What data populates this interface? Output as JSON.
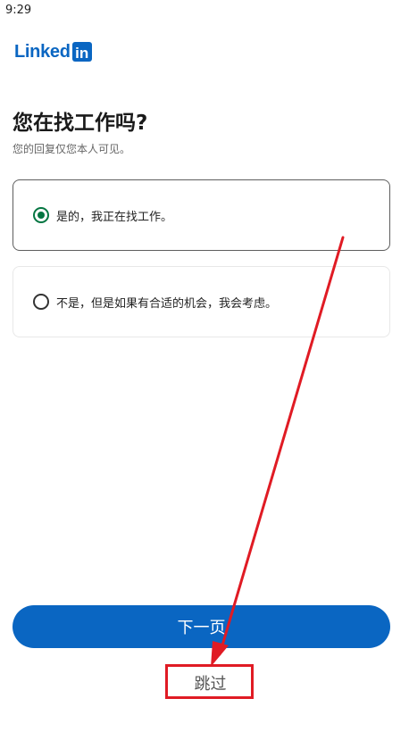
{
  "status_bar": {
    "time": "9:29"
  },
  "logo": {
    "word": "Linked",
    "box": "in"
  },
  "question": {
    "title": "您在找工作吗?",
    "subtitle": "您的回复仅您本人可见。"
  },
  "options": [
    {
      "label": "是的，我正在找工作。",
      "selected": true
    },
    {
      "label": "不是，但是如果有合适的机会，我会考虑。",
      "selected": false
    }
  ],
  "actions": {
    "next_label": "下一页",
    "skip_label": "跳过"
  },
  "colors": {
    "brand": "#0a66c2",
    "selected_radio": "#057642",
    "annotation": "#e01b24"
  }
}
